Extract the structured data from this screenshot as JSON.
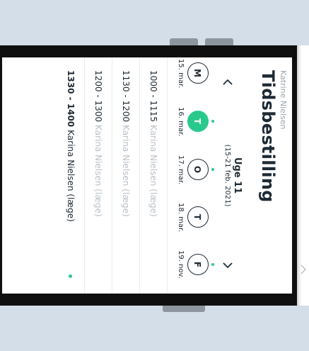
{
  "owner_name": "Katrine Nielsen",
  "title": "Tidsbestilling",
  "week": {
    "label": "Uge 11",
    "range": "(15-21 feb. 2021)",
    "prev_icon": "chevron-left-icon",
    "next_icon": "chevron-right-icon"
  },
  "days": [
    {
      "letter": "M",
      "date": "15. mar.",
      "active": false,
      "dot": false
    },
    {
      "letter": "T",
      "date": "16. mar.",
      "active": true,
      "dot": true
    },
    {
      "letter": "O",
      "date": "17. mar.",
      "active": false,
      "dot": true
    },
    {
      "letter": "T",
      "date": "18. mar.",
      "active": false,
      "dot": false
    },
    {
      "letter": "F",
      "date": "19. nov.",
      "active": false,
      "dot": true
    }
  ],
  "slots": [
    {
      "time": "1000 - 1115",
      "doctor": "Karina Nielsen (læge)",
      "selected": false
    },
    {
      "time": "1130 - 1200",
      "doctor": "Karina Nielsen (læge)",
      "selected": false
    },
    {
      "time": "1200 - 1300",
      "doctor": "Karina Nielsen (læge)",
      "selected": false
    },
    {
      "time": "1330 - 1400",
      "doctor": "Karina Nielsen (læge)",
      "selected": true
    }
  ],
  "colors": {
    "accent": "#29c98b",
    "text": "#1e2a34",
    "muted": "#b9c0c6",
    "device_bg": "#d4dee8"
  }
}
